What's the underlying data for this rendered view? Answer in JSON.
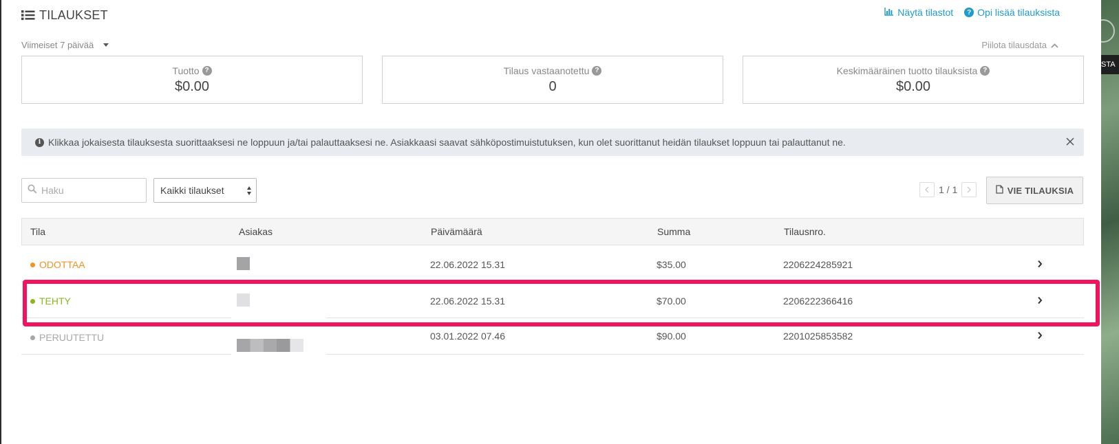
{
  "header": {
    "title": "TILAUKSET",
    "links": [
      {
        "label": "Näytä tilastot",
        "icon": "bar-chart-icon"
      },
      {
        "label": "Opi lisää tilauksista",
        "icon": "question-circle-icon"
      }
    ]
  },
  "range": {
    "label": "Viimeiset 7 päivää"
  },
  "hide_toggle": {
    "label": "Piilota tilausdata"
  },
  "stats": [
    {
      "label": "Tuotto",
      "value": "$0.00"
    },
    {
      "label": "Tilaus vastaanotettu",
      "value": "0"
    },
    {
      "label": "Keskimääräinen tuotto tilauksista",
      "value": "$0.00"
    }
  ],
  "banner": {
    "text": "Klikkaa jokaisesta tilauksesta suorittaaksesi ne loppuun ja/tai palauttaaksesi ne. Asiakkaasi saavat sähköpostimuistutuksen, kun olet suorittanut heidän tilaukset loppuun tai palauttanut ne."
  },
  "search": {
    "placeholder": "Haku",
    "value": ""
  },
  "filter": {
    "selected": "Kaikki tilaukset"
  },
  "pager": {
    "text": "1 / 1"
  },
  "export": {
    "label": "VIE TILAUKSIA"
  },
  "table": {
    "columns": [
      "Tila",
      "Asiakas",
      "Päivämäärä",
      "Summa",
      "Tilausnro."
    ],
    "rows": [
      {
        "status": "ODOTTAA",
        "status_color": "#f39325",
        "date": "22.06.2022 15.31",
        "sum": "$35.00",
        "order_no": "2206224285921"
      },
      {
        "status": "TEHTY",
        "status_color": "#8cb521",
        "date": "22.06.2022 15.31",
        "sum": "$70.00",
        "order_no": "2206222366416"
      },
      {
        "status": "PERUUTETTU",
        "status_color": "#a8a8a8",
        "date": "03.01.2022 07.46",
        "sum": "$90.00",
        "order_no": "2201025853582"
      }
    ]
  },
  "side_label": "STA",
  "colors": {
    "accent": "#1f9bd1",
    "highlight": "#f0135f"
  }
}
